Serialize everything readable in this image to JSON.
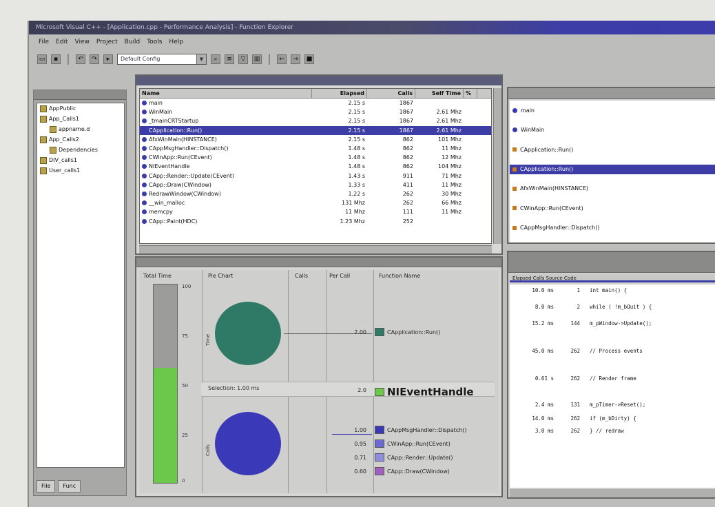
{
  "window": {
    "title": "Microsoft Visual C++ - [Application.cpp - Performance Analysis] - Function Explorer"
  },
  "menubar": [
    "File",
    "Edit",
    "View",
    "Project",
    "Build",
    "Tools",
    "Help"
  ],
  "toolbar": {
    "combo_value": "Default Config"
  },
  "left_pane": {
    "tree_items": [
      "AppPublic",
      "App_Calls1",
      "appname.d",
      "App_Calls2",
      "Dependencies",
      "DIV_calls1",
      "User_calls1"
    ],
    "tabs": [
      "File",
      "Func"
    ]
  },
  "function_list": {
    "columns": [
      "Name",
      "Elapsed",
      "Calls",
      "Self Time",
      "%"
    ],
    "rows": [
      {
        "name": "main",
        "elapsed": "2.15 s",
        "calls": "1867",
        "self": ""
      },
      {
        "name": "WinMain",
        "elapsed": "2.15 s",
        "calls": "1867",
        "self": "2.61 Mhz"
      },
      {
        "name": "_tmainCRTStartup",
        "elapsed": "2.15 s",
        "calls": "1867",
        "self": "2.61 Mhz"
      },
      {
        "name": "CApplication::Run()",
        "elapsed": "2.15 s",
        "calls": "1867",
        "self": "2.61 Mhz",
        "selected": true
      },
      {
        "name": "AfxWinMain(HINSTANCE)",
        "elapsed": "2.15 s",
        "calls": "862",
        "self": "101 Mhz"
      },
      {
        "name": "CAppMsgHandler::Dispatch()",
        "elapsed": "1.48 s",
        "calls": "862",
        "self": "11 Mhz"
      },
      {
        "name": "CWinApp::Run(CEvent)",
        "elapsed": "1.48 s",
        "calls": "862",
        "self": "12 Mhz"
      },
      {
        "name": "NIEventHandle",
        "elapsed": "1.48 s",
        "calls": "862",
        "self": "104 Mhz"
      },
      {
        "name": "CApp::Render::Update(CEvent)",
        "elapsed": "1.43 s",
        "calls": "911",
        "self": "71 Mhz"
      },
      {
        "name": "CApp::Draw(CWindow)",
        "elapsed": "1.33 s",
        "calls": "411",
        "self": "11 Mhz"
      },
      {
        "name": "RedrawWindow(CWindow)",
        "elapsed": "1.22 s",
        "calls": "262",
        "self": "30 Mhz"
      },
      {
        "name": "__win_malloc",
        "elapsed": "131 Mhz",
        "calls": "262",
        "self": "66 Mhz"
      },
      {
        "name": "memcpy",
        "elapsed": "11 Mhz",
        "calls": "111",
        "self": "11 Mhz"
      },
      {
        "name": "CApp::Paint(HDC)",
        "elapsed": "1.23 Mhz",
        "calls": "252",
        "self": ""
      }
    ]
  },
  "callers": {
    "rows": [
      "main",
      "WinMain",
      "CApplication::Run()",
      "CApplication::Run()",
      "AfxWinMain(HINSTANCE)",
      "CWinApp::Run(CEvent)",
      "CAppMsgHandler::Dispatch()"
    ]
  },
  "chart": {
    "col_headers": [
      "Total Time",
      "Pie Chart",
      "Calls",
      "Per Call",
      "Function Name"
    ],
    "bar_fraction": 0.58,
    "axis_ticks": [
      "100",
      "75",
      "50",
      "25",
      "0"
    ],
    "top_pie_label": "Time",
    "bottom_pie_label": "Calls",
    "middle_label": "Selection: 1.00 ms",
    "legend": [
      {
        "value": "2.00",
        "label": "CApplication::Run()",
        "color": "#2f7a66"
      },
      {
        "value": "2.0",
        "label": "NIEventHandle",
        "color": "#6cc84a",
        "big": true
      },
      {
        "value": "1.00",
        "label": "CAppMsgHandler::Dispatch()",
        "color": "#3a3ab8"
      },
      {
        "value": "0.95",
        "label": "CWinApp::Run(CEvent)",
        "color": "#6a6ad0"
      },
      {
        "value": "0.71",
        "label": "CApp::Render::Update()",
        "color": "#8e8ee0"
      },
      {
        "value": "0.60",
        "label": "CApp::Draw(CWindow)",
        "color": "#a060c0"
      }
    ]
  },
  "source": {
    "header": "Elapsed  Calls  Source Code",
    "lines": [
      {
        "t": "10.0 ms",
        "n": "1",
        "code": "int  main() {"
      },
      {
        "t": "8.0 ms",
        "n": "2",
        "code": "while ( !m_bQuit ) {"
      },
      {
        "t": "15.2 ms",
        "n": "144",
        "code": "  m_pWindow->Update();"
      },
      {
        "t": "45.0 ms",
        "n": "262",
        "code": "  // Process events"
      },
      {
        "t": "0.61 s",
        "n": "262",
        "code": "  // Render frame"
      },
      {
        "t": "2.4 ms",
        "n": "131",
        "code": "  m_pTimer->Reset();"
      },
      {
        "t": "14.0 ms",
        "n": "262",
        "code": "  if (m_bDirty) {"
      },
      {
        "t": "3.0 ms",
        "n": "262",
        "code": "  } // redraw"
      }
    ]
  }
}
